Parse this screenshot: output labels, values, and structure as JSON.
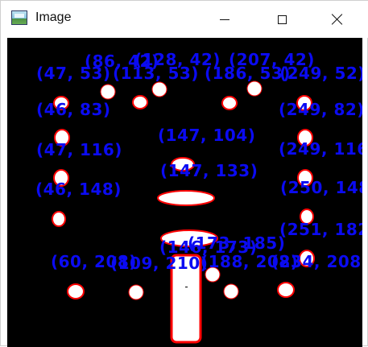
{
  "window": {
    "title": "Image",
    "controls": {
      "minimize": "minimize",
      "maximize": "maximize",
      "close": "close"
    }
  },
  "colors": {
    "background": "#000000",
    "label": "#0b0bf2",
    "contour": "#ff0000",
    "blob": "#ffffff"
  },
  "labels": [
    "(86, 42)",
    "(128, 42)",
    "(207, 42)",
    "(47, 53)",
    "(113, 53)",
    "(186, 53)",
    "(249, 52)",
    "(46, 83)",
    "(249, 82)",
    "(147, 104)",
    "(47, 116)",
    "(249, 116)",
    "(147, 133)",
    "(46, 148)",
    "(250, 148)",
    "(251, 182)",
    "(146, 173)",
    "(173, 185)",
    "(60, 208)",
    "(109, 210)",
    "(188, 208)",
    "(234, 208)"
  ]
}
